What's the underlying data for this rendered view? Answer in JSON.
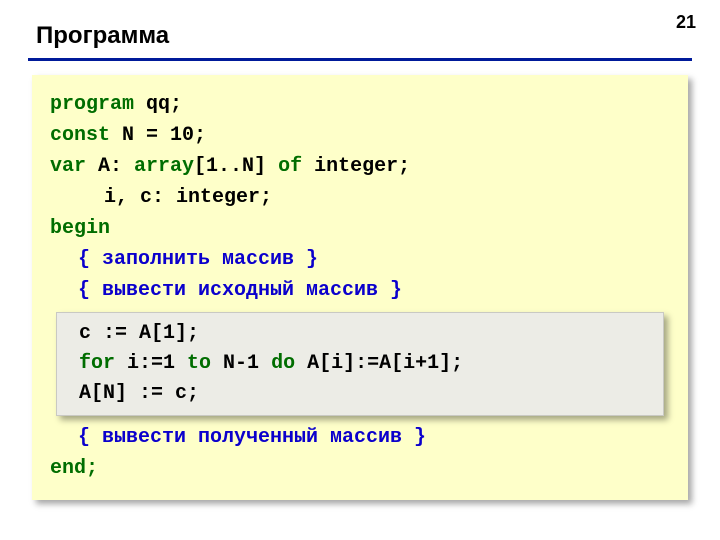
{
  "page_number": "21",
  "title": "Программа",
  "code": {
    "l1a": "program",
    "l1b": " qq;",
    "l2a": "const",
    "l2b": " N = 10;",
    "l3a": "var",
    "l3b": " A: ",
    "l3c": "array",
    "l3d": "[1..N] ",
    "l3e": "of",
    "l3f": " integer;",
    "l4": "i, c: integer;",
    "l5": "begin",
    "c1": "{ заполнить массив }",
    "c2": "{ вывести исходный массив }",
    "c3": "{ вывести полученный массив }",
    "l9": "end;"
  },
  "inner": {
    "i1": "c := A[1];",
    "i2a": "for",
    "i2b": " i:=1 ",
    "i2c": "to",
    "i2d": " N-1 ",
    "i2e": "do",
    "i2f": " A[i]:=A[i+1];",
    "i3": "A[N] := c;"
  }
}
